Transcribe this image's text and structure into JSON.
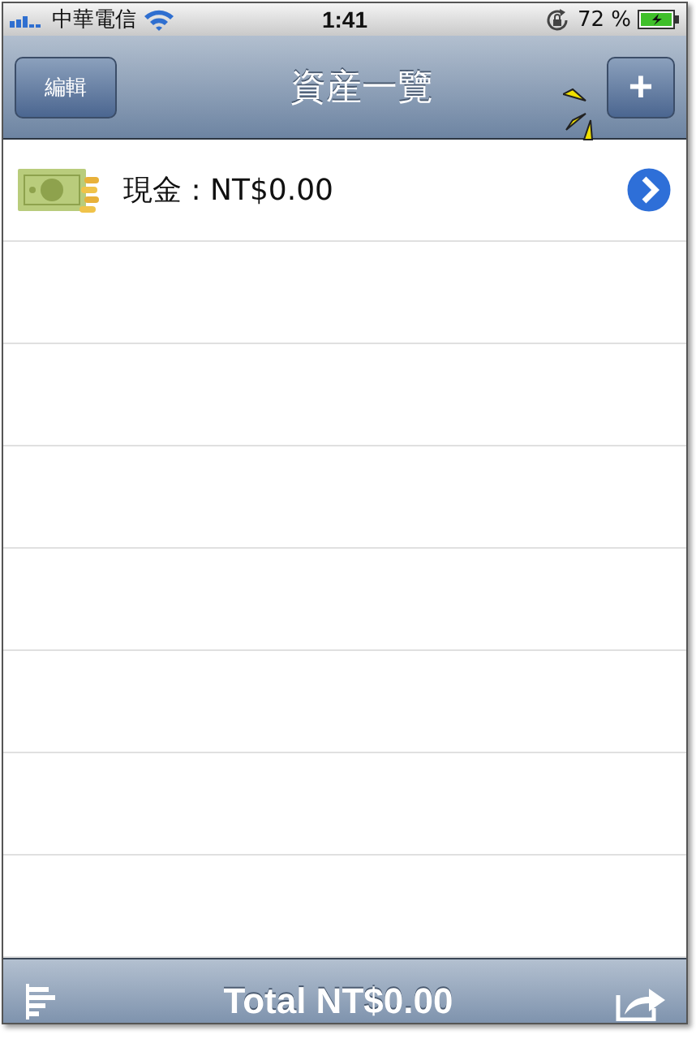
{
  "status_bar": {
    "carrier": "中華電信",
    "time": "1:41",
    "battery": "72 %"
  },
  "nav_bar": {
    "title": "資産一覽",
    "left_button": "編輯",
    "right_button": "+"
  },
  "rows": [
    {
      "label": "現金 : NT$0.00"
    }
  ],
  "toolbar": {
    "total": "Total NT$0.00"
  }
}
